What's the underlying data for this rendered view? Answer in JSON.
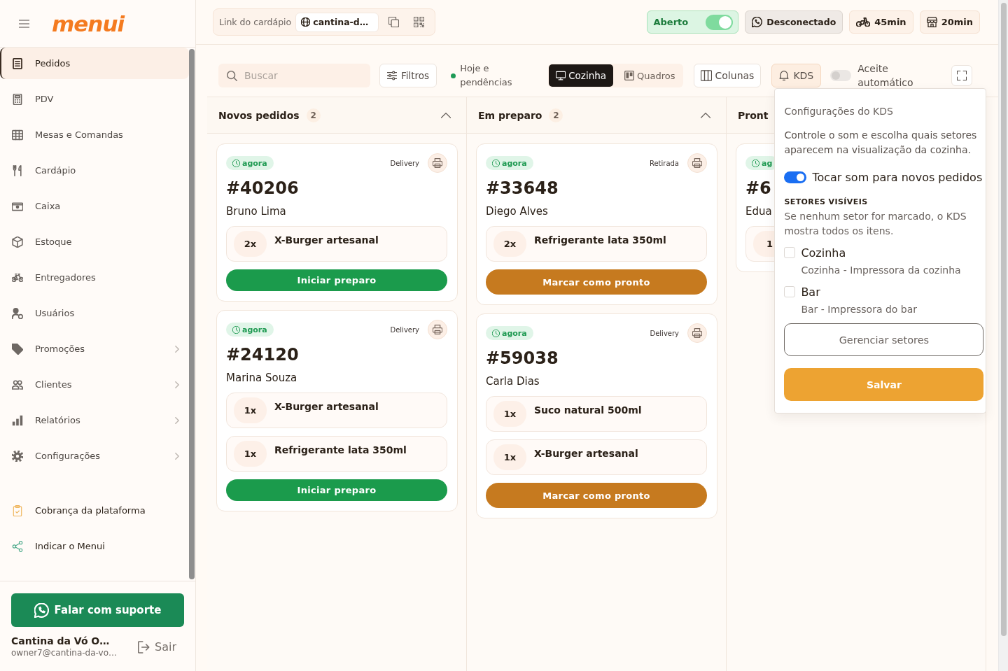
{
  "sidebar": {
    "logo": "menui",
    "nav": [
      {
        "label": "Pedidos",
        "selected": true,
        "expandable": false
      },
      {
        "label": "PDV",
        "selected": false,
        "expandable": false
      },
      {
        "label": "Mesas e Comandas",
        "selected": false,
        "expandable": false
      },
      {
        "label": "Cardápio",
        "selected": false,
        "expandable": false
      },
      {
        "label": "Caixa",
        "selected": false,
        "expandable": false
      },
      {
        "label": "Estoque",
        "selected": false,
        "expandable": false
      },
      {
        "label": "Entregadores",
        "selected": false,
        "expandable": false
      },
      {
        "label": "Usuários",
        "selected": false,
        "expandable": false
      },
      {
        "label": "Promoções",
        "selected": false,
        "expandable": true
      },
      {
        "label": "Clientes",
        "selected": false,
        "expandable": true
      },
      {
        "label": "Relatórios",
        "selected": false,
        "expandable": true
      },
      {
        "label": "Configurações",
        "selected": false,
        "expandable": true
      }
    ],
    "links": [
      {
        "label": "Cobrança da plataforma",
        "selected": false
      },
      {
        "label": "Indicar o Menui",
        "selected": false
      }
    ],
    "support_button": "Falar com suporte",
    "account": {
      "name": "Cantina da Vó O…",
      "email": "owner7@cantina-da-vo…"
    },
    "logout_button": "Sair"
  },
  "topbar": {
    "menu_link": {
      "label": "Link do cardápio",
      "value": "cantina-d…"
    },
    "store_status": {
      "label": "Aberto",
      "on": true
    },
    "whatsapp_status": "Desconectado",
    "delivery_time": "45min",
    "pickup_time": "20min"
  },
  "toolbar": {
    "search": {
      "placeholder": "Buscar"
    },
    "filters_button": "Filtros",
    "period": "Hoje e pendências",
    "views": [
      {
        "label": "Cozinha",
        "selected": true
      },
      {
        "label": "Quadros",
        "selected": false
      }
    ],
    "columns_button": "Colunas",
    "kds_button": {
      "label": "KDS",
      "active": true
    },
    "auto_accept": {
      "label": "Aceite automático",
      "on": false
    }
  },
  "board": {
    "columns": [
      {
        "title": "Novos pedidos",
        "count": "2",
        "expanded": true,
        "orders": [
          {
            "time": "agora",
            "type": "Delivery",
            "number": "#40206",
            "customer": "Bruno Lima",
            "items": [
              {
                "qty": "2x",
                "name": "X-Burger artesanal"
              }
            ],
            "action": {
              "label": "Iniciar preparo",
              "kind": "start"
            }
          },
          {
            "time": "agora",
            "type": "Delivery",
            "number": "#24120",
            "customer": "Marina Souza",
            "items": [
              {
                "qty": "1x",
                "name": "X-Burger artesanal"
              },
              {
                "qty": "1x",
                "name": "Refrigerante lata 350ml"
              }
            ],
            "action": {
              "label": "Iniciar preparo",
              "kind": "start"
            }
          }
        ]
      },
      {
        "title": "Em preparo",
        "count": "2",
        "expanded": true,
        "orders": [
          {
            "time": "agora",
            "type": "Retirada",
            "number": "#33648",
            "customer": "Diego Alves",
            "items": [
              {
                "qty": "2x",
                "name": "Refrigerante lata 350ml"
              }
            ],
            "action": {
              "label": "Marcar como pronto",
              "kind": "ready"
            }
          },
          {
            "time": "agora",
            "type": "Delivery",
            "number": "#59038",
            "customer": "Carla Dias",
            "items": [
              {
                "qty": "1x",
                "name": "Suco natural 500ml"
              },
              {
                "qty": "1x",
                "name": "X-Burger artesanal"
              }
            ],
            "action": {
              "label": "Marcar como pronto",
              "kind": "ready"
            }
          }
        ]
      },
      {
        "title": "Pront",
        "orders": [
          {
            "time": "ag",
            "number": "#6",
            "customer": "Edua",
            "items": [
              {
                "qty": "1"
              }
            ]
          }
        ]
      }
    ]
  },
  "kds_settings": {
    "title": "Configurações do KDS",
    "description": "Controle o som e escolha quais setores aparecem na visualização da cozinha.",
    "sound": {
      "label": "Tocar som para novos pedidos",
      "on": true
    },
    "sectors_heading": "SETORES VISÍVEIS",
    "sectors_hint": "Se nenhum setor for marcado, o KDS mostra todos os itens.",
    "sectors": [
      {
        "name": "Cozinha",
        "detail": "Cozinha - Impressora da cozinha",
        "checked": false
      },
      {
        "name": "Bar",
        "detail": "Bar - Impressora do bar",
        "checked": false
      }
    ],
    "manage_button": "Gerenciar setores",
    "save_button": "Salvar"
  }
}
